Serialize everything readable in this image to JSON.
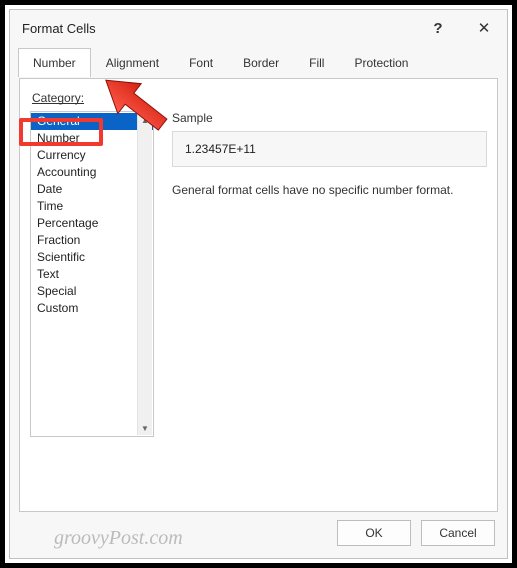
{
  "dialog": {
    "title": "Format Cells"
  },
  "tabs": [
    {
      "label": "Number",
      "active": true
    },
    {
      "label": "Alignment",
      "active": false
    },
    {
      "label": "Font",
      "active": false
    },
    {
      "label": "Border",
      "active": false
    },
    {
      "label": "Fill",
      "active": false
    },
    {
      "label": "Protection",
      "active": false
    }
  ],
  "category": {
    "label": "Category:",
    "items": [
      "General",
      "Number",
      "Currency",
      "Accounting",
      "Date",
      "Time",
      "Percentage",
      "Fraction",
      "Scientific",
      "Text",
      "Special",
      "Custom"
    ],
    "selected_index": 0,
    "highlight_index": 1
  },
  "sample": {
    "label": "Sample",
    "value": "1.23457E+11"
  },
  "description": "General format cells have no specific number format.",
  "buttons": {
    "ok": "OK",
    "cancel": "Cancel"
  },
  "watermark": "groovyPost.com",
  "annotation": {
    "target_item": "Number"
  }
}
